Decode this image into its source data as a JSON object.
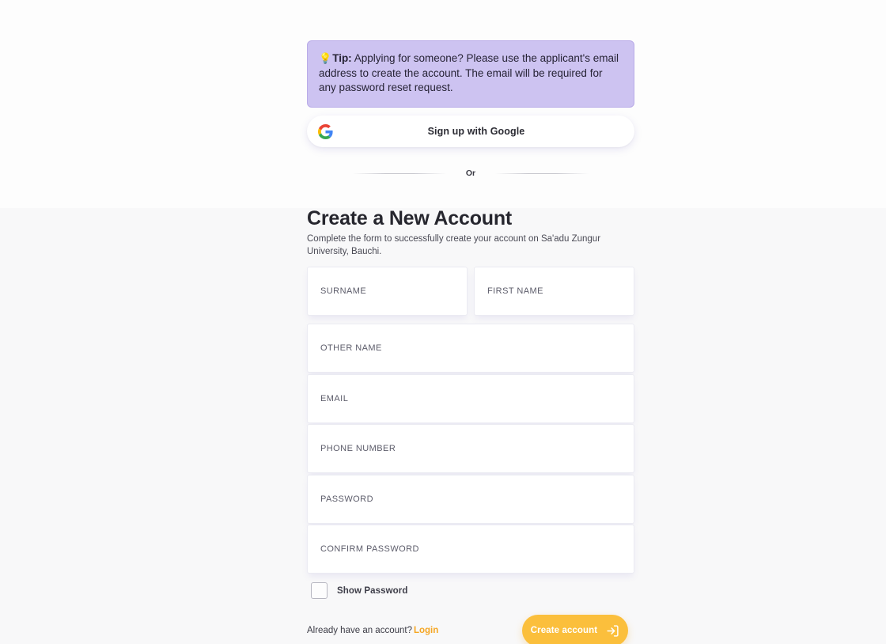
{
  "tip": {
    "icon": "lightbulb-icon",
    "label": "Tip:",
    "text": " Applying for someone? Please use the applicant's email address to create the account. The email will be required for any password reset request."
  },
  "oauth": {
    "google_label": "Sign up with Google",
    "google_icon": "google-g-icon"
  },
  "divider": {
    "label": "Or"
  },
  "form": {
    "title": "Create a New Account",
    "subtitle": "Complete the form to successfully create your account on Sa'adu Zungur University, Bauchi.",
    "fields": [
      {
        "name": "surname",
        "placeholder": "SURNAME",
        "value": ""
      },
      {
        "name": "first-name",
        "placeholder": "FIRST NAME",
        "value": ""
      },
      {
        "name": "other-name",
        "placeholder": "OTHER NAME",
        "value": ""
      },
      {
        "name": "email",
        "placeholder": "EMAIL",
        "value": ""
      },
      {
        "name": "phone-number",
        "placeholder": "PHONE NUMBER",
        "value": ""
      },
      {
        "name": "password",
        "placeholder": "PASSWORD",
        "value": ""
      },
      {
        "name": "confirm-password",
        "placeholder": "CONFIRM PASSWORD",
        "value": ""
      }
    ],
    "show_password": {
      "label": "Show Password",
      "checked": false
    }
  },
  "footer": {
    "login_prompt": "Already have an account?",
    "login_link": "Login",
    "submit_label": "Create account",
    "submit_icon": "log-in-arrow-icon"
  },
  "colors": {
    "tip_background": "#cdc3f1",
    "tip_border": "#b9abe8",
    "accent": "#fbbf3c",
    "link": "#f5a623",
    "page_background": "#fdfdfd",
    "page_background_lower": "#f8f8f9",
    "field_background": "#ffffff"
  }
}
